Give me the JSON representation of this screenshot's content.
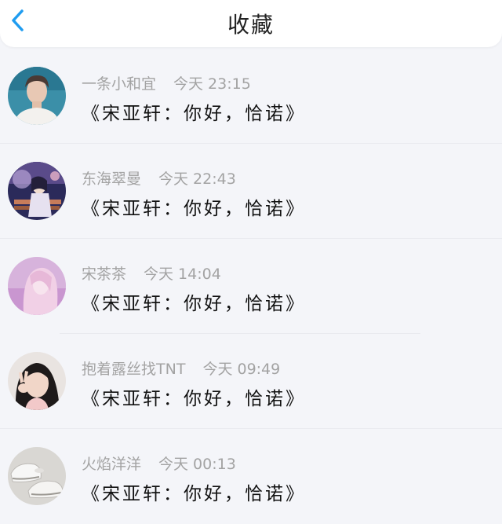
{
  "header": {
    "title": "收藏",
    "back_icon": "chevron-left-icon",
    "accent_color": "#1f9cf0"
  },
  "favorites": [
    {
      "name": "一条小和宜",
      "time": "今天 23:15",
      "message": "《宋亚轩：你好，恰诺》",
      "avatar": "avatar-boy-portrait"
    },
    {
      "name": "东海翠曼",
      "time": "今天 22:43",
      "message": "《宋亚轩：你好，恰诺》",
      "avatar": "avatar-anime-scene"
    },
    {
      "name": "宋茶茶",
      "time": "今天 14:04",
      "message": "《宋亚轩：你好，恰诺》",
      "avatar": "avatar-pink-girl"
    },
    {
      "name": "抱着露丝找TNT",
      "time": "今天 09:49",
      "message": "《宋亚轩：你好，恰诺》",
      "avatar": "avatar-peace-sign-girl"
    },
    {
      "name": "火焰洋洋",
      "time": "今天 00:13",
      "message": "《宋亚轩：你好，恰诺》",
      "avatar": "avatar-sneakers"
    }
  ]
}
